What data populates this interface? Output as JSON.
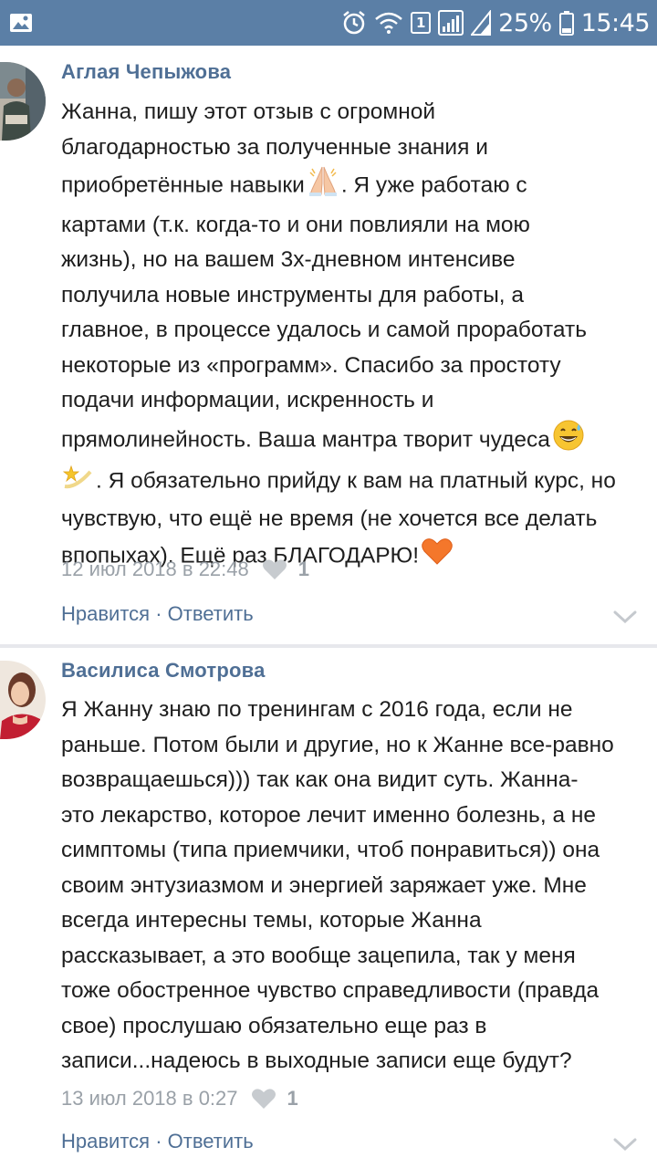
{
  "status_bar": {
    "sim_number": "1",
    "battery": "25%",
    "time": "15:45"
  },
  "comments": [
    {
      "author": "Аглая Чепыжова",
      "lines": [
        "Жанна, пишу этот отзыв с огромной",
        "благодарностью за полученные знания и",
        "приобретённые навыки",
        ". Я уже работаю с",
        "картами (т.к. когда-то и они повлияли на мою",
        "жизнь), но на вашем 3х-дневном интенсиве",
        "получила новые инструменты для работы, а",
        "главное, в процессе удалось и самой проработать",
        "некоторые из «программ». Спасибо за простоту",
        "подачи информации, искренность и",
        "прямолинейность. Ваша мантра творит чудеса",
        ". Я обязательно прийду к вам на платный курс, но",
        "чувствую, что ещё не время (не хочется все делать",
        "впопыхах). Ещё раз БЛАГОДАРЮ!"
      ],
      "date": "12 июл 2018 в 22:48",
      "likes": "1",
      "like_label": "Нравится",
      "separator": " · ",
      "reply_label": "Ответить"
    },
    {
      "author": "Василиса Смотрова",
      "lines": [
        "Я Жанну знаю по тренингам с 2016 года, если не",
        "раньше. Потом были и другие, но к Жанне все-равно",
        "возвращаешься))) так как она видит суть. Жанна-",
        "это лекарство, которое лечит именно болезнь, а не",
        "симптомы (типа приемчики, чтоб понравиться)) она",
        "своим энтузиазмом и энергией заряжает уже. Мне",
        "всегда интересны темы, которые Жанна",
        "рассказывает, а это вообще зацепила, так у меня",
        "тоже обостренное чувство справедливости (правда",
        "свое) прослушаю обязательно еще раз в",
        "записи...надеюсь в выходные записи еще будут?"
      ],
      "date": "13 июл 2018 в 0:27",
      "likes": "1",
      "like_label": "Нравится",
      "separator": " · ",
      "reply_label": "Ответить"
    }
  ],
  "icons": {
    "gallery": "gallery-icon",
    "alarm": "alarm-icon",
    "wifi": "wifi-icon",
    "signal": "signal-icon",
    "battery": "battery-icon",
    "praying_hands": "praying-hands-emoji",
    "grinning_sweat": "grinning-sweat-emoji",
    "dizzy": "dizzy-emoji",
    "heart_emoji": "orange-heart-emoji",
    "like": "heart-icon",
    "expand": "chevron-down-icon"
  },
  "colors": {
    "status_bar": "#5b7fa6",
    "author": "#4f6f95",
    "action_link": "#4f6f95",
    "meta": "#9aa1a8",
    "divider": "#e7e8ec"
  }
}
